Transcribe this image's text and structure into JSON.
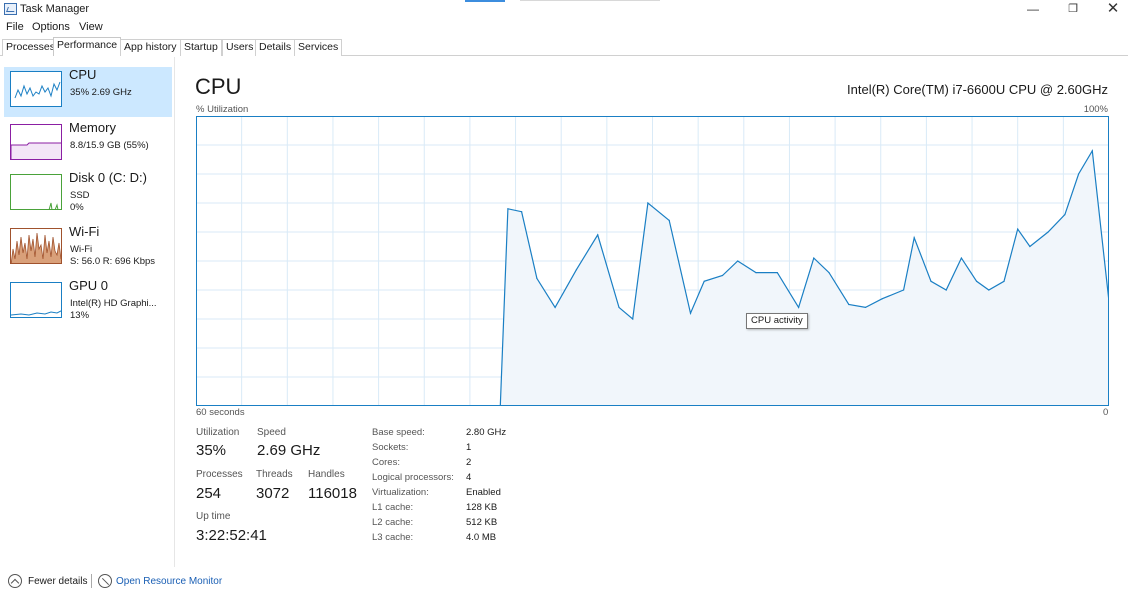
{
  "window": {
    "title": "Task Manager",
    "minimize": "—",
    "maximize": "❐",
    "close": "✕"
  },
  "menu": [
    "File",
    "Options",
    "View"
  ],
  "tabs": [
    "Processes",
    "Performance",
    "App history",
    "Startup",
    "Users",
    "Details",
    "Services"
  ],
  "active_tab": "Performance",
  "sidebar": [
    {
      "title": "CPU",
      "line1": "35% 2.69 GHz",
      "line2": "",
      "color": "#1a7fc4",
      "selected": true
    },
    {
      "title": "Memory",
      "line1": "8.8/15.9 GB (55%)",
      "line2": "",
      "color": "#8b1fa3",
      "selected": false
    },
    {
      "title": "Disk 0 (C: D:)",
      "line1": "SSD",
      "line2": "0%",
      "color": "#4aa23a",
      "selected": false
    },
    {
      "title": "Wi-Fi",
      "line1": "Wi-Fi",
      "line2": "S: 56.0  R: 696 Kbps",
      "color": "#a0522d",
      "selected": false
    },
    {
      "title": "GPU 0",
      "line1": "Intel(R) HD Graphi...",
      "line2": "13%",
      "color": "#1a7fc4",
      "selected": false
    }
  ],
  "main": {
    "title": "CPU",
    "model": "Intel(R) Core(TM) i7-6600U CPU @ 2.60GHz",
    "util_label": "% Utilization",
    "max_label": "100%",
    "time_label": "60 seconds",
    "min_label": "0",
    "tooltip": "CPU activity"
  },
  "stats": {
    "utilization": {
      "label": "Utilization",
      "value": "35%"
    },
    "speed": {
      "label": "Speed",
      "value": "2.69 GHz"
    },
    "processes": {
      "label": "Processes",
      "value": "254"
    },
    "threads": {
      "label": "Threads",
      "value": "3072"
    },
    "handles": {
      "label": "Handles",
      "value": "116018"
    },
    "uptime": {
      "label": "Up time",
      "value": "3:22:52:41"
    }
  },
  "specs": [
    {
      "key": "Base speed:",
      "value": "2.80 GHz"
    },
    {
      "key": "Sockets:",
      "value": "1"
    },
    {
      "key": "Cores:",
      "value": "2"
    },
    {
      "key": "Logical processors:",
      "value": "4"
    },
    {
      "key": "Virtualization:",
      "value": "Enabled"
    },
    {
      "key": "L1 cache:",
      "value": "128 KB"
    },
    {
      "key": "L2 cache:",
      "value": "512 KB"
    },
    {
      "key": "L3 cache:",
      "value": "4.0 MB"
    }
  ],
  "footer": {
    "fewer_details": "Fewer details",
    "resource_monitor": "Open Resource Monitor"
  },
  "chart_data": {
    "type": "area",
    "ylim": [
      0,
      100
    ],
    "xlim": [
      60,
      0
    ],
    "x": [
      60,
      40,
      39.5,
      38.6,
      37.6,
      36.4,
      35,
      33.6,
      32.2,
      31.3,
      30.3,
      28.9,
      27.5,
      26.6,
      25.4,
      24.4,
      23.2,
      21.8,
      20.4,
      19.4,
      18.4,
      17.1,
      16,
      14.9,
      13.5,
      12.8,
      11.7,
      10.7,
      9.7,
      8.7,
      7.9,
      6.9,
      6,
      5.2,
      4,
      2.9,
      2,
      1.1,
      0
    ],
    "y": [
      0,
      0,
      68,
      67,
      44,
      34,
      47,
      59,
      34,
      30,
      70,
      64,
      32,
      43,
      45,
      50,
      46,
      46,
      34,
      51,
      46,
      35,
      34,
      37,
      40,
      58,
      43,
      40,
      51,
      43,
      40,
      43,
      61,
      55,
      60,
      66,
      80,
      88,
      36
    ]
  }
}
